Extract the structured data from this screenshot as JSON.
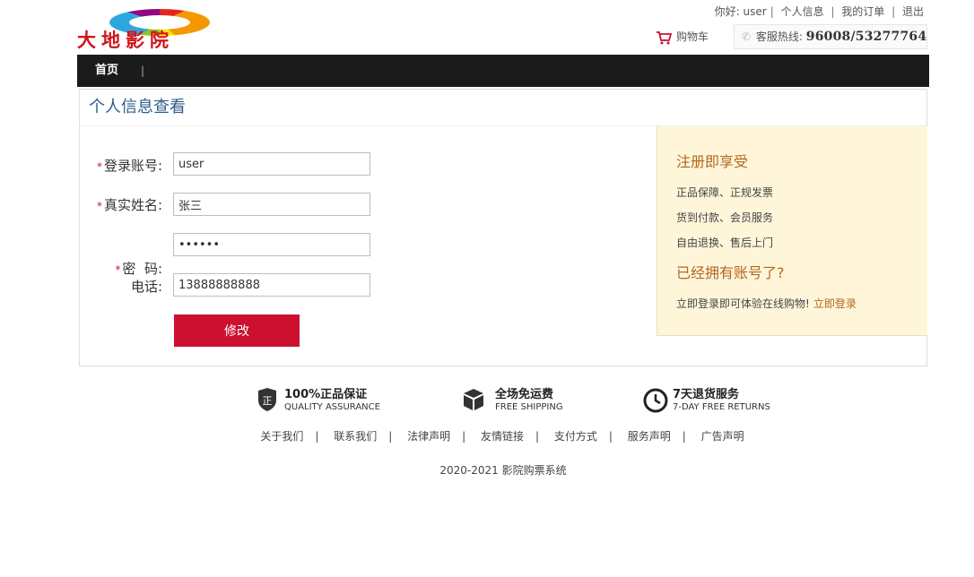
{
  "header": {
    "logo_text": "大地影院",
    "greeting": "你好:",
    "username": "user",
    "links": [
      "个人信息",
      "我的订单",
      "退出"
    ],
    "cart_label": "购物车",
    "hotline_label": "客服热线:",
    "hotline_number": "96008/53277764"
  },
  "nav": {
    "home": "首页",
    "separator": "|"
  },
  "panel": {
    "title": "个人信息查看"
  },
  "form": {
    "required_mark": "*",
    "fields": [
      {
        "label": "登录账号:",
        "value": "user",
        "required": true
      },
      {
        "label": "真实姓名:",
        "value": "张三",
        "required": true
      },
      {
        "label": "密  码:",
        "value": "••••••",
        "required": true
      },
      {
        "label": "电话:",
        "value": "13888888888",
        "required": false
      }
    ],
    "submit_label": "修改"
  },
  "promo": {
    "heading1": "注册即享受",
    "items": [
      "正品保障、正规发票",
      "货到付款、会员服务",
      "自由退换、售后上门"
    ],
    "heading2": "已经拥有账号了?",
    "login_text": "立即登录即可体验在线购物!",
    "login_link": "立即登录"
  },
  "footer": {
    "features": [
      {
        "title": "100%正品保证",
        "subtitle": "QUALITY ASSURANCE",
        "icon": "shield-icon",
        "icon_char": "正"
      },
      {
        "title": "全场免运费",
        "subtitle": "FREE SHIPPING",
        "icon": "box-icon"
      },
      {
        "title": "7天退货服务",
        "subtitle": "7-DAY FREE RETURNS",
        "icon": "clock-icon"
      }
    ],
    "links": [
      "关于我们",
      "联系我们",
      "法律声明",
      "友情链接",
      "支付方式",
      "服务声明",
      "广告声明"
    ],
    "link_separator": "|",
    "copyright": "2020-2021 影院购票系统"
  },
  "colors": {
    "accent_red": "#cc1030",
    "nav_bg": "#1b1b1b",
    "title_blue": "#2e5d8e",
    "promo_bg": "#fff6da",
    "promo_text": "#b4661f"
  }
}
